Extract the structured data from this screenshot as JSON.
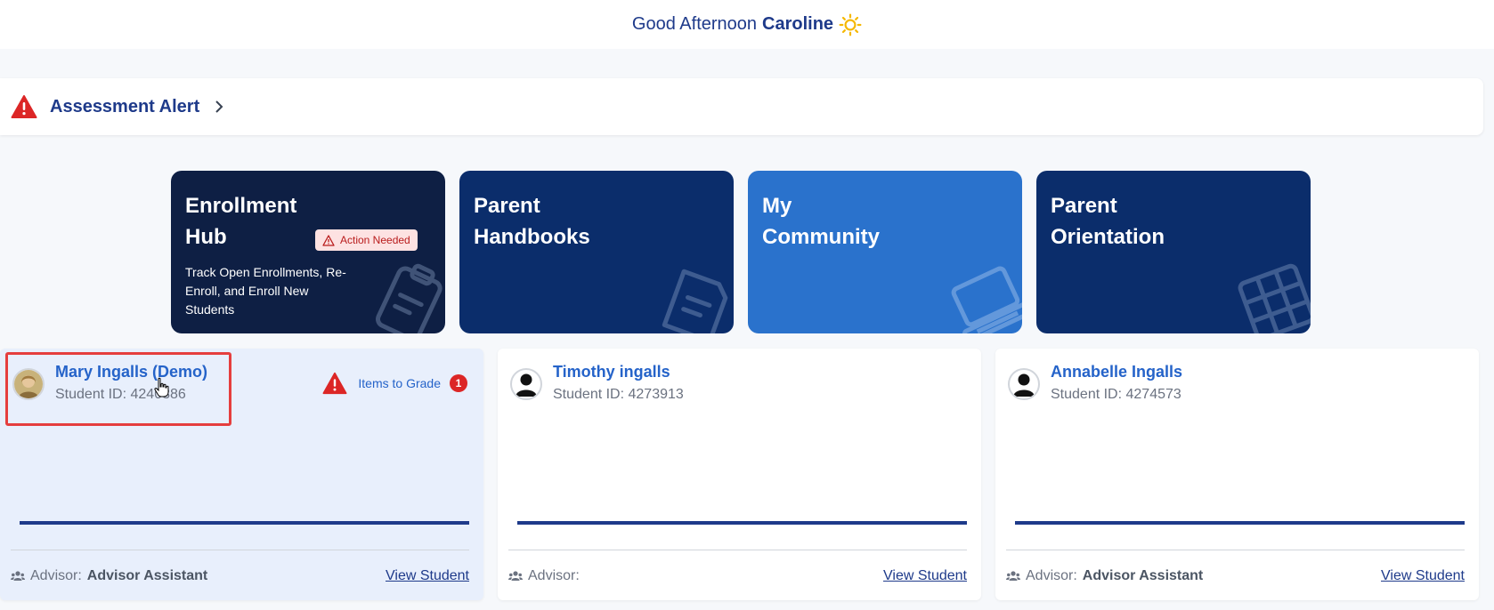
{
  "greeting": {
    "text": "Good Afternoon",
    "name": "Caroline"
  },
  "alert": {
    "label": "Assessment Alert"
  },
  "tiles": [
    {
      "title": "Enrollment Hub",
      "badge": "Action Needed",
      "desc": "Track Open Enrollments, Re-Enroll, and Enroll New Students",
      "icon": "clipboard-icon"
    },
    {
      "title": "Parent Handbooks",
      "icon": "book-icon"
    },
    {
      "title": "My Community",
      "icon": "laptop-icon"
    },
    {
      "title": "Parent Orientation",
      "icon": "calendar-icon"
    }
  ],
  "students": [
    {
      "name": "Mary Ingalls (Demo)",
      "id_label": "Student ID: 4240386",
      "grade_label": "Items to Grade",
      "grade_count": "1",
      "advisor_label": "Advisor:",
      "advisor_name": "Advisor Assistant",
      "view_label": "View Student",
      "progress": 0
    },
    {
      "name": "Timothy ingalls",
      "id_label": "Student ID: 4273913",
      "advisor_label": "Advisor:",
      "advisor_name": "",
      "view_label": "View Student",
      "progress": 0
    },
    {
      "name": "Annabelle Ingalls",
      "id_label": "Student ID: 4274573",
      "advisor_label": "Advisor:",
      "advisor_name": "Advisor Assistant",
      "view_label": "View Student",
      "progress": 0
    }
  ],
  "colors": {
    "brand": "#1e3a8a",
    "link": "#2563c9",
    "alert": "#dc2626",
    "tile_dark": "#0e1f44",
    "tile_navy": "#0b2d6b",
    "tile_blue": "#2a72cc"
  }
}
